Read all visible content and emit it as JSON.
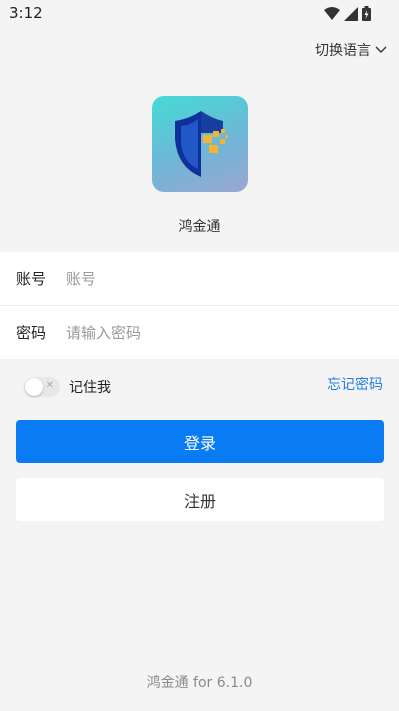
{
  "status_bar": {
    "time": "3:12",
    "icons": [
      "wifi-icon",
      "signal-icon",
      "battery-icon"
    ]
  },
  "header": {
    "language_switch_label": "切换语言",
    "language_icon": "chevron-down-icon"
  },
  "app": {
    "name": "鸿金通",
    "logo": "shield-logo-icon"
  },
  "form": {
    "account_label": "账号",
    "account_placeholder": "账号",
    "account_value": "",
    "password_label": "密码",
    "password_placeholder": "请输入密码",
    "password_value": ""
  },
  "remember": {
    "label": "记住我",
    "enabled": false
  },
  "forgot_password": "忘记密码",
  "buttons": {
    "login": "登录",
    "register": "注册"
  },
  "footer": {
    "version": "鸿金通 for 6.1.0"
  },
  "colors": {
    "primary": "#0a7cf3",
    "link": "#1f7fe0",
    "background": "#f4f4f4"
  }
}
